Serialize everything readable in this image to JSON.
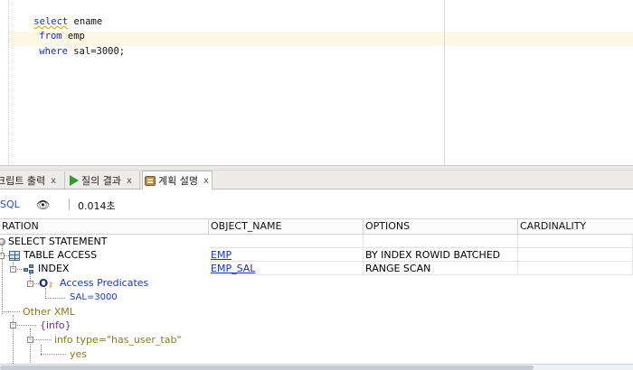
{
  "editor": {
    "lines": [
      {
        "keyword": "select",
        "rest": " ename"
      },
      {
        "keyword": "from",
        "rest": " emp"
      },
      {
        "keyword": "where",
        "rest": " sal=3000;"
      }
    ]
  },
  "tabs": [
    {
      "label": "크립트 출력",
      "close": "x"
    },
    {
      "label": "질의 결과",
      "close": "x"
    },
    {
      "label": "계획 설명",
      "close": "x"
    }
  ],
  "toolbar": {
    "sql_label": "SQL",
    "elapsed": "0.014초"
  },
  "grid": {
    "columns": [
      "RATION",
      "OBJECT_NAME",
      "OPTIONS",
      "CARDINALITY"
    ],
    "rows": [
      {
        "operation": "SELECT STATEMENT",
        "object_name": "",
        "options": ""
      },
      {
        "operation": "TABLE ACCESS",
        "object_name": "EMP",
        "options": "BY INDEX ROWID BATCHED"
      },
      {
        "operation": "INDEX",
        "object_name": "EMP_SAL",
        "options": "RANGE SCAN"
      }
    ],
    "tree": {
      "access_predicates": "Access Predicates",
      "predicate": "SAL=3000",
      "other_xml": "Other XML",
      "info": "{info}",
      "info_type": "info type=\"has_user_tab\"",
      "yes": "yes"
    }
  },
  "colors": {
    "keyword": "#1b2bd1",
    "link": "#1530c8",
    "tree_blue": "#1d37c6",
    "tree_olive": "#8a7a18",
    "tree_purple": "#7a2a9a",
    "current_line": "#fdf8e4"
  }
}
